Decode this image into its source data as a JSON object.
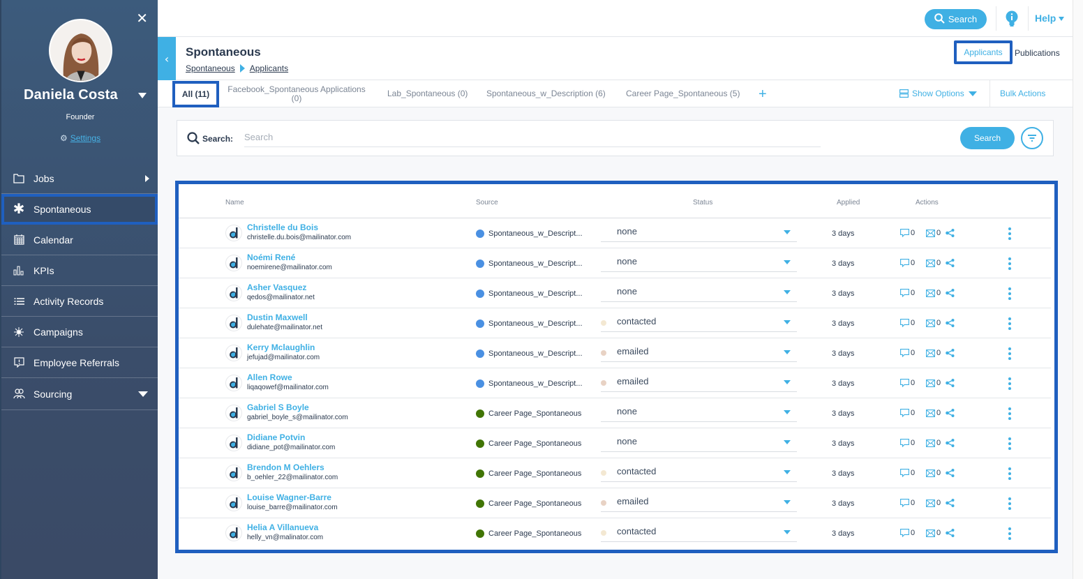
{
  "sidebar": {
    "user": {
      "name": "Daniela Costa",
      "role": "Founder",
      "settings_label": "Settings"
    },
    "items": [
      {
        "label": "Jobs",
        "icon": "folder-icon",
        "indicator": "arrow-right"
      },
      {
        "label": "Spontaneous",
        "icon": "asterisk-icon",
        "active": true
      },
      {
        "label": "Calendar",
        "icon": "calendar-icon"
      },
      {
        "label": "KPIs",
        "icon": "bar-chart-icon"
      },
      {
        "label": "Activity Records",
        "icon": "list-icon"
      },
      {
        "label": "Campaigns",
        "icon": "network-icon"
      },
      {
        "label": "Employee Referrals",
        "icon": "referral-icon"
      },
      {
        "label": "Sourcing",
        "icon": "users-icon",
        "indicator": "arrow-down"
      }
    ]
  },
  "topbar": {
    "search_label": "Search",
    "help_label": "Help"
  },
  "page": {
    "title": "Spontaneous",
    "breadcrumb": [
      "Spontaneous",
      "Applicants"
    ],
    "views": {
      "applicants": "Applicants",
      "publications": "Publications"
    }
  },
  "tabs": {
    "items": [
      {
        "label": "All (11)",
        "active": true
      },
      {
        "label": "Facebook_Spontaneous Applications (0)"
      },
      {
        "label": "Lab_Spontaneous (0)"
      },
      {
        "label": "Spontaneous_w_Description (6)"
      },
      {
        "label": "Career Page_Spontaneous (5)"
      }
    ],
    "add_label": "+",
    "show_options": "Show Options",
    "bulk_actions": "Bulk Actions"
  },
  "search": {
    "label": "Search:",
    "placeholder": "Search",
    "value": "",
    "button": "Search"
  },
  "table": {
    "columns": {
      "name": "Name",
      "source": "Source",
      "status": "Status",
      "applied": "Applied",
      "actions": "Actions"
    },
    "source_colors": {
      "Spontaneous_w_Descript...": "#4a90e2",
      "Career Page_Spontaneous": "#417505"
    },
    "status_colors": {
      "none": "",
      "contacted": "#f3e8d2",
      "emailed": "#e8d2c4"
    },
    "rows": [
      {
        "name": "Christelle du Bois",
        "email": "christelle.du.bois@mailinator.com",
        "source": "Spontaneous_w_Descript...",
        "status": "none",
        "applied": "3 days",
        "notes": "0",
        "mails": "0"
      },
      {
        "name": "Noémi René",
        "email": "noemirene@mailinator.com",
        "source": "Spontaneous_w_Descript...",
        "status": "none",
        "applied": "3 days",
        "notes": "0",
        "mails": "0"
      },
      {
        "name": "Asher Vasquez",
        "email": "qedos@mailinator.net",
        "source": "Spontaneous_w_Descript...",
        "status": "none",
        "applied": "3 days",
        "notes": "0",
        "mails": "0"
      },
      {
        "name": "Dustin Maxwell",
        "email": "dulehate@mailinator.net",
        "source": "Spontaneous_w_Descript...",
        "status": "contacted",
        "applied": "3 days",
        "notes": "0",
        "mails": "0"
      },
      {
        "name": "Kerry Mclaughlin",
        "email": "jefujad@mailinator.com",
        "source": "Spontaneous_w_Descript...",
        "status": "emailed",
        "applied": "3 days",
        "notes": "0",
        "mails": "0"
      },
      {
        "name": "Allen Rowe",
        "email": "liqaqowef@mailinator.com",
        "source": "Spontaneous_w_Descript...",
        "status": "emailed",
        "applied": "3 days",
        "notes": "0",
        "mails": "0"
      },
      {
        "name": "Gabriel S Boyle",
        "email": "gabriel_boyle_s@mailinator.com",
        "source": "Career Page_Spontaneous",
        "status": "none",
        "applied": "3 days",
        "notes": "0",
        "mails": "0"
      },
      {
        "name": "Didiane Potvin",
        "email": "didiane_pot@mailinator.com",
        "source": "Career Page_Spontaneous",
        "status": "none",
        "applied": "3 days",
        "notes": "0",
        "mails": "0"
      },
      {
        "name": "Brendon M Oehlers",
        "email": "b_oehler_22@mailinator.com",
        "source": "Career Page_Spontaneous",
        "status": "contacted",
        "applied": "3 days",
        "notes": "0",
        "mails": "0"
      },
      {
        "name": "Louise Wagner-Barre",
        "email": "louise_barre@mailinator.com",
        "source": "Career Page_Spontaneous",
        "status": "emailed",
        "applied": "3 days",
        "notes": "0",
        "mails": "0"
      },
      {
        "name": "Helia A Villanueva",
        "email": "helly_vn@malinator.com",
        "source": "Career Page_Spontaneous",
        "status": "contacted",
        "applied": "3 days",
        "notes": "0",
        "mails": "0"
      }
    ]
  },
  "colors": {
    "accent": "#3fb0e4",
    "highlight": "#1f5fbf",
    "sidebar": "#3c5b7c",
    "text": "#2b3a4f"
  }
}
